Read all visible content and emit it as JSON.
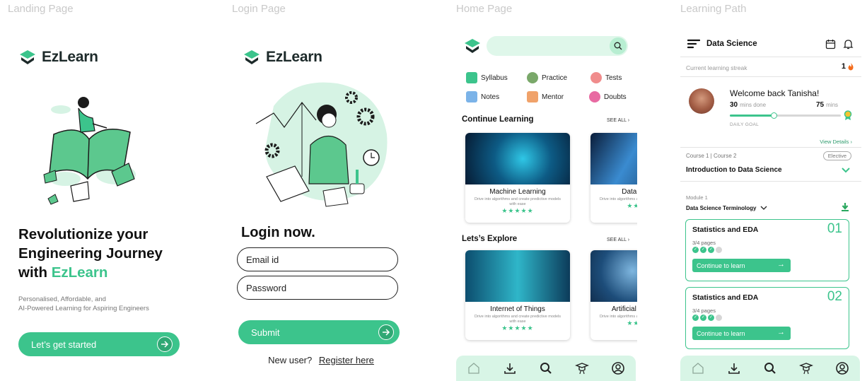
{
  "frames": {
    "landing": "Landing Page",
    "login": "Login Page",
    "home": "Home Page",
    "learning": "Learning Path"
  },
  "brand": {
    "name": "EzLearn",
    "accent": "#3cc48c",
    "dark": "#1d2a2a"
  },
  "landing": {
    "title_line1": "Revolutionize your",
    "title_line2": "Engineering Journey",
    "title_with": "with ",
    "title_brand": "EzLearn",
    "sub_line1": "Personalised, Affordable, and",
    "sub_line2": "AI-Powered Learning for Aspiring Engineers",
    "cta": "Let’s get started"
  },
  "login": {
    "heading": "Login now.",
    "email": "Email id",
    "password": "Password",
    "submit": "Submit",
    "new_user": "New user?",
    "register": "Register here"
  },
  "home": {
    "categories": [
      {
        "label": "Syllabus",
        "icon": "syllabus-icon"
      },
      {
        "label": "Practice",
        "icon": "practice-icon"
      },
      {
        "label": "Tests",
        "icon": "tests-icon"
      },
      {
        "label": "Notes",
        "icon": "notes-icon"
      },
      {
        "label": "Mentor",
        "icon": "mentor-icon"
      },
      {
        "label": "Doubts",
        "icon": "doubts-icon"
      }
    ],
    "continue": {
      "title": "Continue Learning",
      "see_all": "SEE ALL  ›",
      "cards": [
        {
          "title": "Machine Learning",
          "desc": "Drive into algorithms and create predictive models with ease",
          "stars": "★★★★★"
        },
        {
          "title": "Data Science",
          "desc": "Drive into algorithms and create predictive models",
          "stars": "★★★★★"
        }
      ]
    },
    "explore": {
      "title": "Lets’s Explore",
      "see_all": "SEE ALL  ›",
      "cards": [
        {
          "title": "Internet of Things",
          "desc": "Drive into algorithms and create predictive models with ease",
          "stars": "★★★★★"
        },
        {
          "title": "Artificial Intelligence",
          "desc": "Drive into algorithms and create predictive models",
          "stars": "★★★★★"
        }
      ]
    },
    "nav": [
      "home-icon",
      "download-icon",
      "search-icon",
      "graduate-icon",
      "profile-icon"
    ]
  },
  "learning": {
    "header": "Data Science",
    "streak_label": "Current learning streak",
    "streak_value": "1",
    "welcome": "Welcome back Tanisha!",
    "done_value": "30",
    "done_label": "mins done",
    "total_value": "75",
    "total_label": "mins",
    "progress": 0.4,
    "daily_goal": "DAILY GOAL",
    "view_details": "View Details  ›",
    "course_crumb": "Course 1  |  Course 2",
    "elective": "Elective",
    "course_title": "Introduction to Data Science",
    "module_label": "Module 1",
    "module_name": "Data Science Terminology",
    "modules": [
      {
        "title": "Statistics and EDA",
        "num": "01",
        "pages": "3/4 pages",
        "completed": 3,
        "total": 4,
        "button": "Continue to learn"
      },
      {
        "title": "Statistics and EDA",
        "num": "02",
        "pages": "3/4 pages",
        "completed": 3,
        "total": 4,
        "button": "Continue to learn"
      }
    ]
  }
}
